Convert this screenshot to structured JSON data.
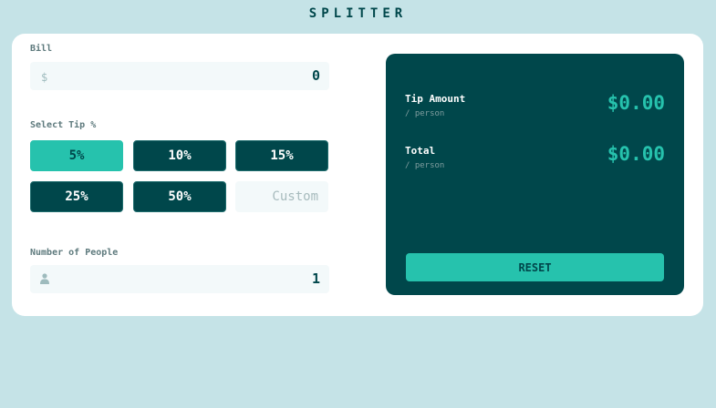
{
  "app": {
    "title": "SPLITTER"
  },
  "bill": {
    "label": "Bill",
    "currency_icon": "$",
    "value": "0"
  },
  "tip": {
    "label": "Select Tip %",
    "options": [
      "5%",
      "10%",
      "15%",
      "25%",
      "50%"
    ],
    "selected": "5%",
    "custom_placeholder": "Custom"
  },
  "people": {
    "label": "Number of People",
    "icon": "person-icon",
    "value": "1"
  },
  "results": {
    "tip_amount": {
      "label": "Tip Amount",
      "sub": "/ person",
      "value": "$0.00"
    },
    "total": {
      "label": "Total",
      "sub": "/ person",
      "value": "$0.00"
    },
    "reset_label": "RESET"
  },
  "colors": {
    "background": "#c5e3e7",
    "dark_teal": "#00474b",
    "accent": "#26c2ad",
    "input_bg": "#f3f9fa"
  }
}
